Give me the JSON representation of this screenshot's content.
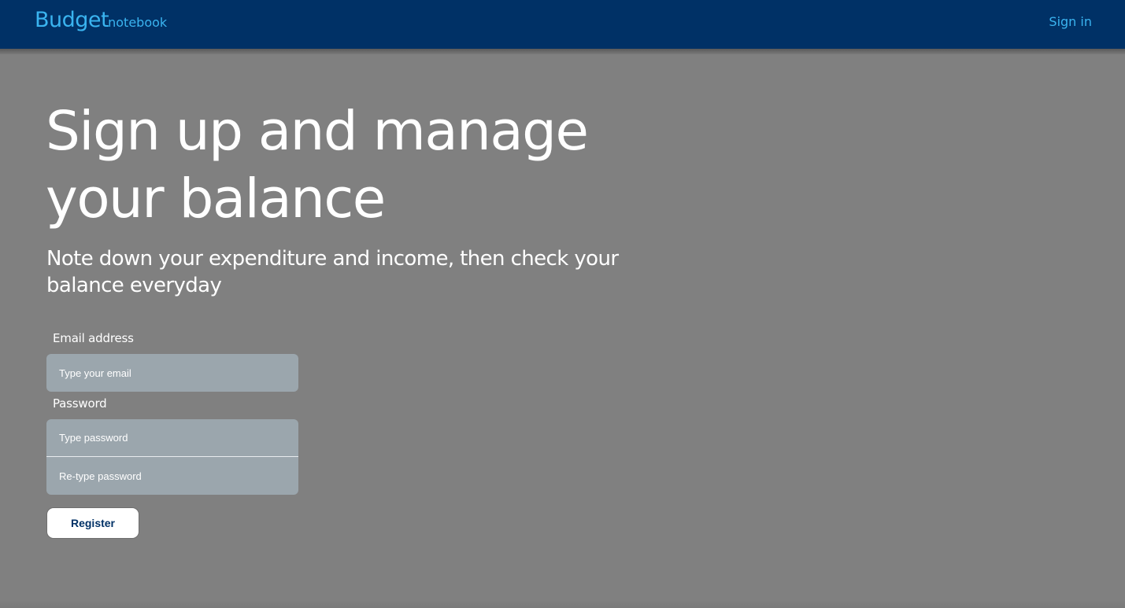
{
  "header": {
    "brand_main": "Budget",
    "brand_sub": "notebook",
    "signin_label": "Sign in",
    "background_color": "#003166",
    "accent_color": "#3ab4f0"
  },
  "hero": {
    "title": "Sign up and manage your balance",
    "subtitle": "Note down your expenditure and income, then check your balance everyday"
  },
  "form": {
    "email_label": "Email address",
    "email_placeholder": "Type your email",
    "email_value": "",
    "password_label": "Password",
    "password_placeholder": "Type password",
    "password_value": "",
    "repassword_placeholder": "Re-type password",
    "repassword_value": "",
    "register_label": "Register"
  }
}
